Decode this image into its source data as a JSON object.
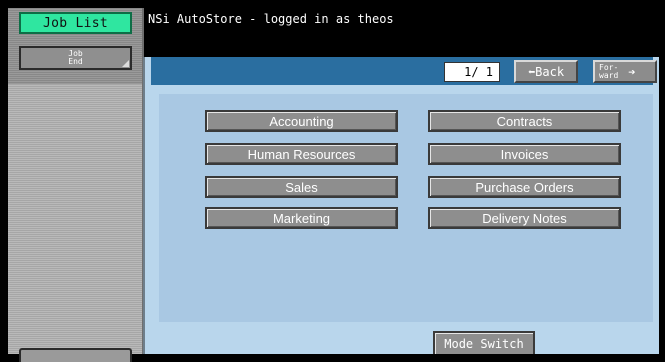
{
  "title": "NSi AutoStore - logged in as theos",
  "sidebar": {
    "job_list_label": "Job List",
    "job_end_line1": "Job",
    "job_end_line2": "End"
  },
  "pager": {
    "page_indicator": "1/ 1",
    "back_label": "⬅Back",
    "forward_line1": "For-",
    "forward_line2": "ward",
    "forward_arrow": "➔"
  },
  "categories": [
    "Accounting",
    "Contracts",
    "Human Resources",
    "Invoices",
    "Sales",
    "Purchase Orders",
    "Marketing",
    "Delivery Notes"
  ],
  "mode_switch_label": "Mode Switch",
  "colors": {
    "job_list_accent": "#2fe6a0",
    "toolbar": "#2a6ea0",
    "panel_bg": "#b9d6ec"
  }
}
